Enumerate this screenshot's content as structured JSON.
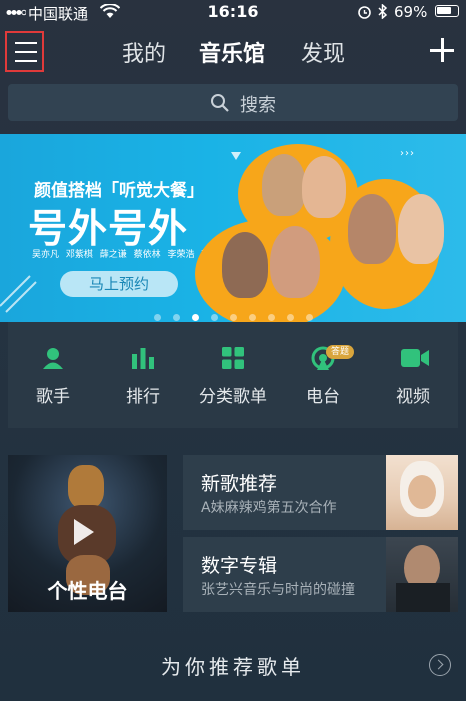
{
  "status_bar": {
    "carrier": "中国联通",
    "time": "16:16",
    "battery": "69%"
  },
  "nav": {
    "tabs": [
      {
        "label": "我的"
      },
      {
        "label": "音乐馆"
      },
      {
        "label": "发现"
      }
    ]
  },
  "search": {
    "placeholder": "搜索"
  },
  "banner": {
    "subtitle": "颜值搭档「听觉大餐」",
    "title": "号外号外",
    "names": "吴亦凡 邓紫棋 薛之谦 蔡依林 李荣浩 韩雪",
    "cta": "马上预约",
    "slide_count": 9,
    "active_slide": 2
  },
  "quick_nav": [
    {
      "label": "歌手",
      "icon": "singer-icon"
    },
    {
      "label": "排行",
      "icon": "chart-icon"
    },
    {
      "label": "分类歌单",
      "icon": "grid-icon"
    },
    {
      "label": "电台",
      "icon": "radio-icon",
      "badge": "答题"
    },
    {
      "label": "视频",
      "icon": "video-icon"
    }
  ],
  "featured": {
    "radio": {
      "label": "个性电台"
    },
    "cards": [
      {
        "title": "新歌推荐",
        "desc": "A妹麻辣鸡第五次合作"
      },
      {
        "title": "数字专辑",
        "desc": "张艺兴音乐与时尚的碰撞"
      }
    ]
  },
  "recommend": {
    "title": "为你推荐歌单"
  },
  "colors": {
    "accent_green": "#31c27c",
    "highlight_red": "#e03a3a",
    "badge": "#d9a53c",
    "banner_blue": "#1ab3e6"
  }
}
